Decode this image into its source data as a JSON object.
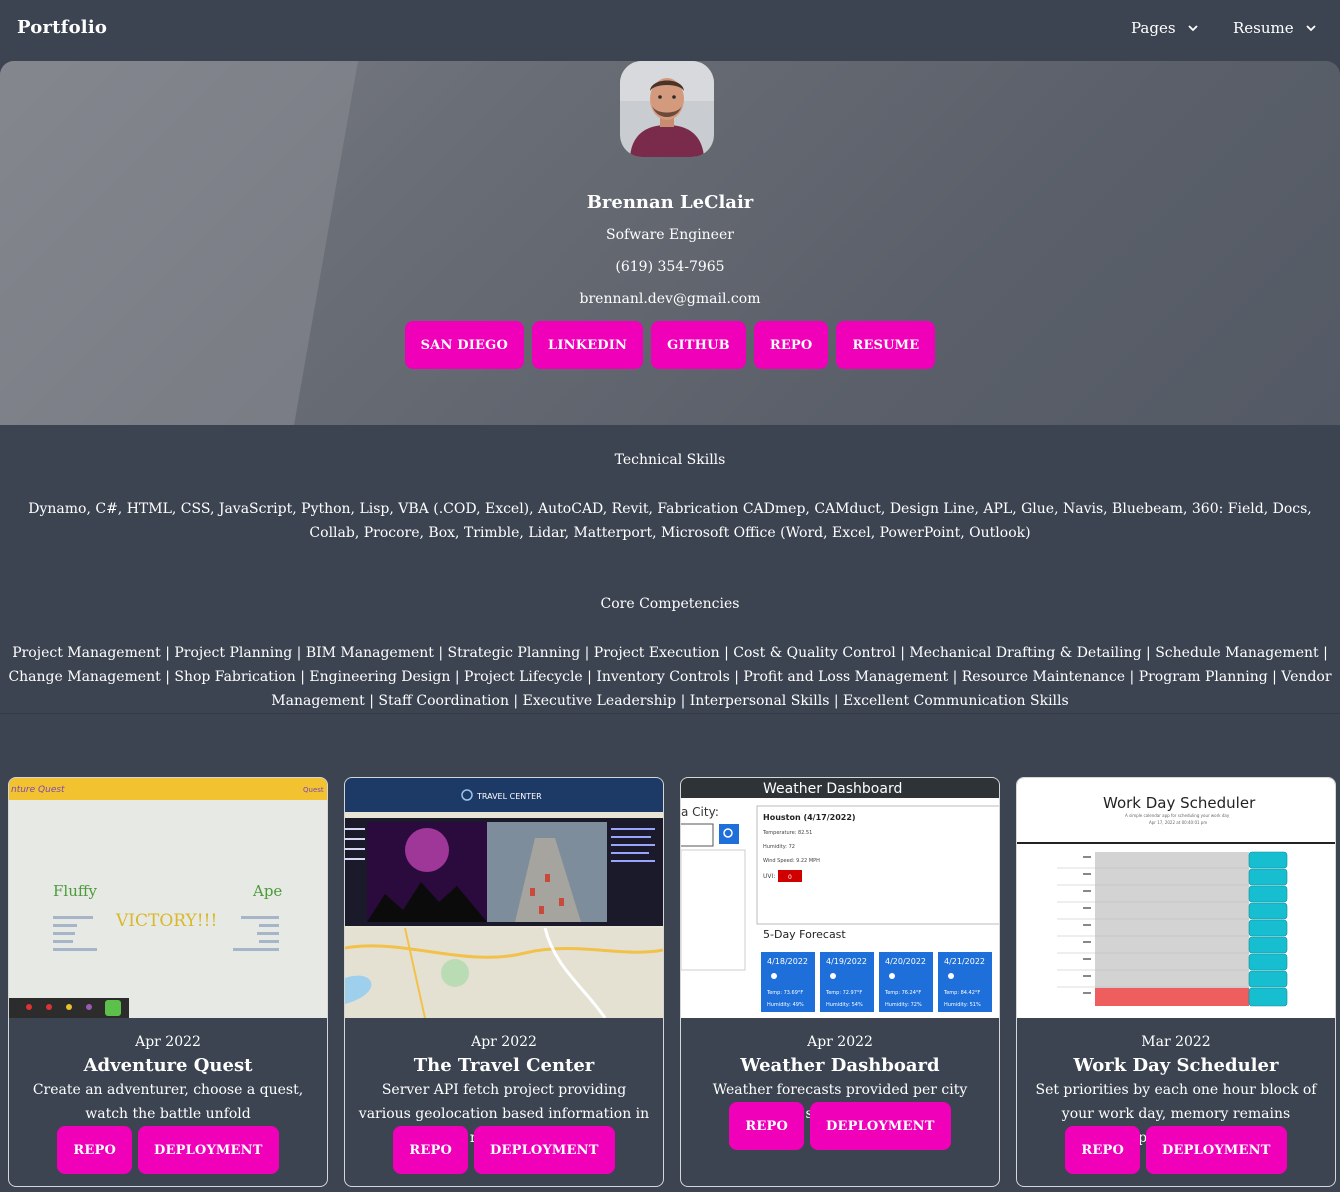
{
  "navbar": {
    "brand": "Portfolio",
    "menus": [
      {
        "label": "Pages",
        "icon": "chevron-down-icon"
      },
      {
        "label": "Resume",
        "icon": "chevron-down-icon"
      }
    ]
  },
  "hero": {
    "name": "Brennan LeClair",
    "title": "Sofware Engineer",
    "phone": "(619) 354-7965",
    "email": "brennanl.dev@gmail.com",
    "buttons": [
      "SAN DIEGO",
      "LINKEDIN",
      "GITHUB",
      "REPO",
      "RESUME"
    ]
  },
  "skills": {
    "technical_title": "Technical Skills",
    "technical_list": "Dynamo, C#, HTML, CSS, JavaScript, Python, Lisp, VBA (.COD, Excel), AutoCAD, Revit, Fabrication CADmep, CAMduct, Design Line, APL, Glue, Navis, Bluebeam, 360: Field, Docs, Collab, Procore, Box, Trimble, Lidar, Matterport, Microsoft Office (Word, Excel, PowerPoint, Outlook)",
    "core_title": "Core Competencies",
    "core_list": "Project Management | Project Planning | BIM Management | Strategic Planning | Project Execution | Cost & Quality Control | Mechanical Drafting & Detailing | Schedule Management | Change Management | Shop Fabrication | Engineering Design | Project Lifecycle | Inventory Controls | Profit and Loss Management | Resource Maintenance | Program Planning | Vendor Management | Staff Coordination | Executive Leadership | Interpersonal Skills | Excellent Communication Skills"
  },
  "projects": [
    {
      "date": "Apr 2022",
      "title": "Adventure Quest",
      "description": "Create an adventurer, choose a quest, watch the battle unfold",
      "buttons": [
        "REPO",
        "DEPLOYMENT"
      ],
      "shot": {
        "header_left": "nture Quest",
        "header_right": "Quest",
        "left": "Fluffy",
        "center": "VICTORY!!!",
        "right": "Ape"
      }
    },
    {
      "date": "Apr 2022",
      "title": "The Travel Center",
      "description": "Server API fetch project providing various geolocation based information in real time.",
      "buttons": [
        "REPO",
        "DEPLOYMENT"
      ],
      "shot": {
        "header": "TRAVEL CENTER"
      }
    },
    {
      "date": "Apr 2022",
      "title": "Weather Dashboard",
      "description": "Weather forecasts provided per city searched.",
      "buttons": [
        "REPO",
        "DEPLOYMENT"
      ],
      "shot": {
        "header": "Weather Dashboard",
        "city_label": "a City:",
        "current": "Houston (4/17/2022)",
        "temp": "Temperature: 82.51",
        "humidity": "Humidity: 72",
        "wind": "Wind Speed: 9.22 MPH",
        "uvi_label": "UVI:",
        "uvi": "0",
        "forecast_title": "5-Day Forecast",
        "forecast": [
          {
            "date": "4/18/2022",
            "temp": "Temp: 73.69°F",
            "hum": "Humidity: 49%"
          },
          {
            "date": "4/19/2022",
            "temp": "Temp: 72.97°F",
            "hum": "Humidity: 54%"
          },
          {
            "date": "4/20/2022",
            "temp": "Temp: 76.24°F",
            "hum": "Humidity: 72%"
          },
          {
            "date": "4/21/2022",
            "temp": "Temp: 84.42°F",
            "hum": "Humidity: 51%"
          }
        ]
      }
    },
    {
      "date": "Mar 2022",
      "title": "Work Day Scheduler",
      "description": "Set priorities by each one hour block of your work day, memory remains persistant.",
      "buttons": [
        "REPO",
        "DEPLOYMENT"
      ],
      "shot": {
        "header": "Work Day Scheduler",
        "sub": "A simple calendar app for scheduling your work day",
        "date": "Apr 17, 2022 at 00:40:01 pm"
      }
    }
  ],
  "colors": {
    "accent": "#f000b8",
    "background": "#3d4451"
  }
}
